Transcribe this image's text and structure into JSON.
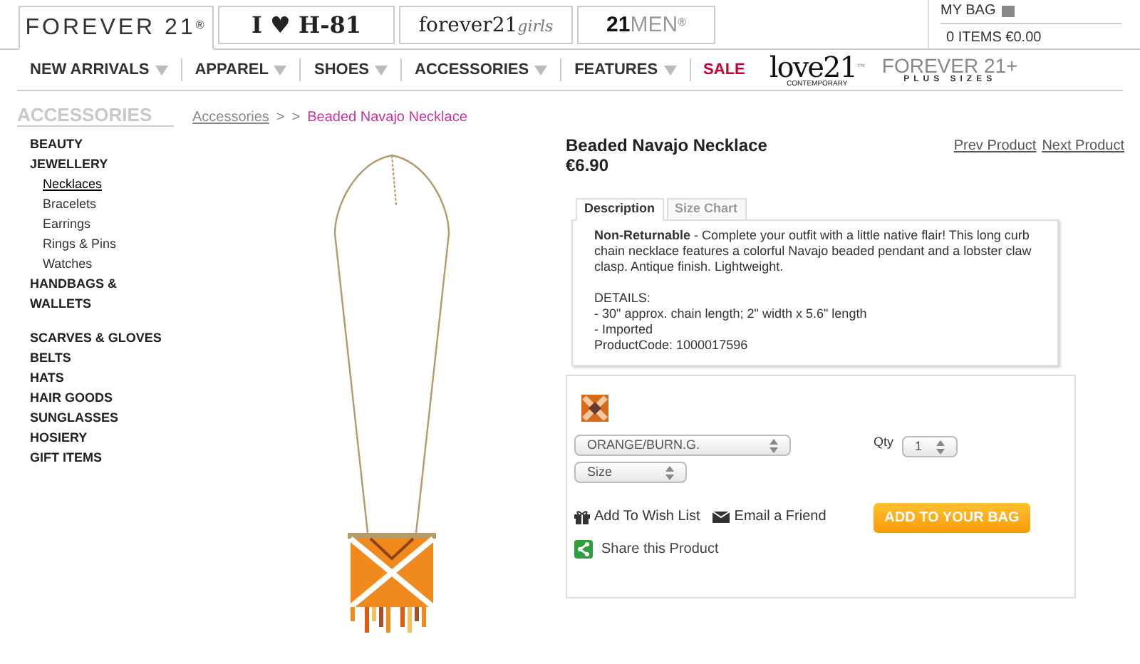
{
  "shop_tabs": [
    {
      "label": "FOREVER 21",
      "mark": "®",
      "kind": "main",
      "selected": true
    },
    {
      "label": "I ♥ H-81",
      "kind": "h81",
      "selected": false
    },
    {
      "label": "forever21",
      "suffix": "girls",
      "kind": "girls",
      "selected": false
    },
    {
      "label": "21",
      "suffix": "MEN",
      "mark": "®",
      "kind": "men",
      "selected": false
    }
  ],
  "bag": {
    "title": "MY BAG",
    "summary": "0 ITEMS €0.00"
  },
  "nav": [
    {
      "label": "NEW ARRIVALS",
      "dropdown": true,
      "sale": false
    },
    {
      "label": "APPAREL",
      "dropdown": true,
      "sale": false
    },
    {
      "label": "SHOES",
      "dropdown": true,
      "sale": false
    },
    {
      "label": "ACCESSORIES",
      "dropdown": true,
      "sale": false
    },
    {
      "label": "FEATURES",
      "dropdown": true,
      "sale": false
    },
    {
      "label": "SALE",
      "dropdown": false,
      "sale": true
    }
  ],
  "nav_logos": [
    {
      "kind": "love21",
      "label": "love21",
      "sub": "CONTEMPORARY",
      "mark": "™"
    },
    {
      "kind": "plus",
      "label": "FOREVER 21+",
      "sub": "PLUS SIZES"
    }
  ],
  "sidebar": {
    "title": "ACCESSORIES",
    "items": [
      {
        "label": "BEAUTY",
        "selected": false
      },
      {
        "label": "JEWELLERY",
        "selected": false,
        "children": [
          {
            "label": "Necklaces",
            "selected": true
          },
          {
            "label": "Bracelets",
            "selected": false
          },
          {
            "label": "Earrings",
            "selected": false
          },
          {
            "label": "Rings & Pins",
            "selected": false
          },
          {
            "label": "Watches",
            "selected": false
          }
        ]
      },
      {
        "label": "HANDBAGS & WALLETS",
        "selected": false
      },
      {
        "label": "SCARVES & GLOVES",
        "selected": false
      },
      {
        "label": "BELTS",
        "selected": false
      },
      {
        "label": "HATS",
        "selected": false
      },
      {
        "label": "HAIR GOODS",
        "selected": false
      },
      {
        "label": "SUNGLASSES",
        "selected": false
      },
      {
        "label": "HOSIERY",
        "selected": false
      },
      {
        "label": "GIFT ITEMS",
        "selected": false
      }
    ]
  },
  "breadcrumb": {
    "link": "Accessories",
    "separators": [
      ">",
      ">"
    ],
    "current": "Beaded Navajo Necklace"
  },
  "product": {
    "name": "Beaded Navajo Necklace",
    "price": "€6.90",
    "prev": "Prev Product",
    "next": "Next Product",
    "tabs": [
      {
        "label": "Description",
        "selected": true
      },
      {
        "label": "Size Chart",
        "selected": false
      }
    ],
    "description": "**Non-Returnable** - Complete your outfit with a little native flair! This long curb chain necklace features a colorful Navajo beaded pendant and a lobster claw clasp. Antique finish. Lightweight.",
    "details": [
      "DETAILS:",
      "- 30\" approx. chain length; 2\" width x 5.6\" length",
      "- Imported",
      "ProductCode: 1000017596"
    ],
    "color_select": "ORANGE/BURN.G.",
    "size_select": "Size",
    "qty_label": "Qty",
    "qty": "1",
    "wish": "Add To Wish List",
    "email": "Email a Friend",
    "share": "Share this Product",
    "add_button": "ADD TO YOUR BAG"
  }
}
